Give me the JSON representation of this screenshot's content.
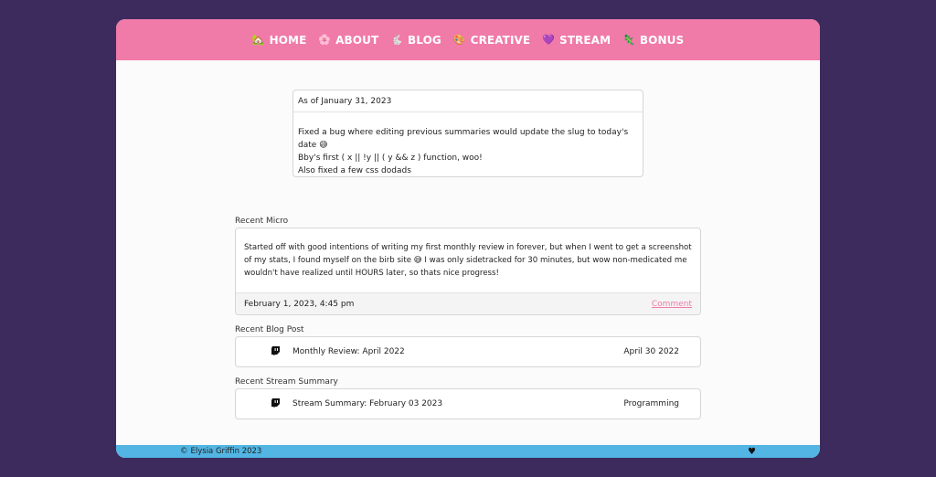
{
  "nav": {
    "items": [
      {
        "icon": "🏡",
        "label": "HOME"
      },
      {
        "icon": "🌸",
        "label": "ABOUT"
      },
      {
        "icon": "🐇",
        "label": "BLOG"
      },
      {
        "icon": "🎨",
        "label": "CREATIVE"
      },
      {
        "icon": "💜",
        "label": "STREAM"
      },
      {
        "icon": "🦎",
        "label": "BONUS"
      }
    ]
  },
  "update": {
    "date": "As of January 31, 2023",
    "lines": [
      "Fixed a bug where editing previous summaries would update the slug to today's date 😅",
      "Bby's first ( x || !y || ( y && z ) function, woo!",
      "Also fixed a few css dodads"
    ]
  },
  "micro": {
    "heading": "Recent Micro",
    "text": "Started off with good intentions of writing my first monthly review in forever, but when I went to get a screenshot of my stats, I found myself on the birb site 😅 I was only sidetracked for 30 minutes, but wow non-medicated me wouldn't have realized until HOURS later, so thats nice progress!",
    "timestamp": "February 1, 2023, 4:45 pm",
    "comment_label": "Comment"
  },
  "blog": {
    "heading": "Recent Blog Post",
    "title": "Monthly Review: April 2022",
    "date": "April 30 2022",
    "icon": "twitch-icon"
  },
  "stream": {
    "heading": "Recent Stream Summary",
    "title": "Stream Summary: February 03 2023",
    "category": "Programming",
    "icon": "twitch-icon"
  },
  "footer": {
    "copyright_symbol": "©",
    "author": "Elysia Griffin 2023",
    "heart": "♥"
  }
}
